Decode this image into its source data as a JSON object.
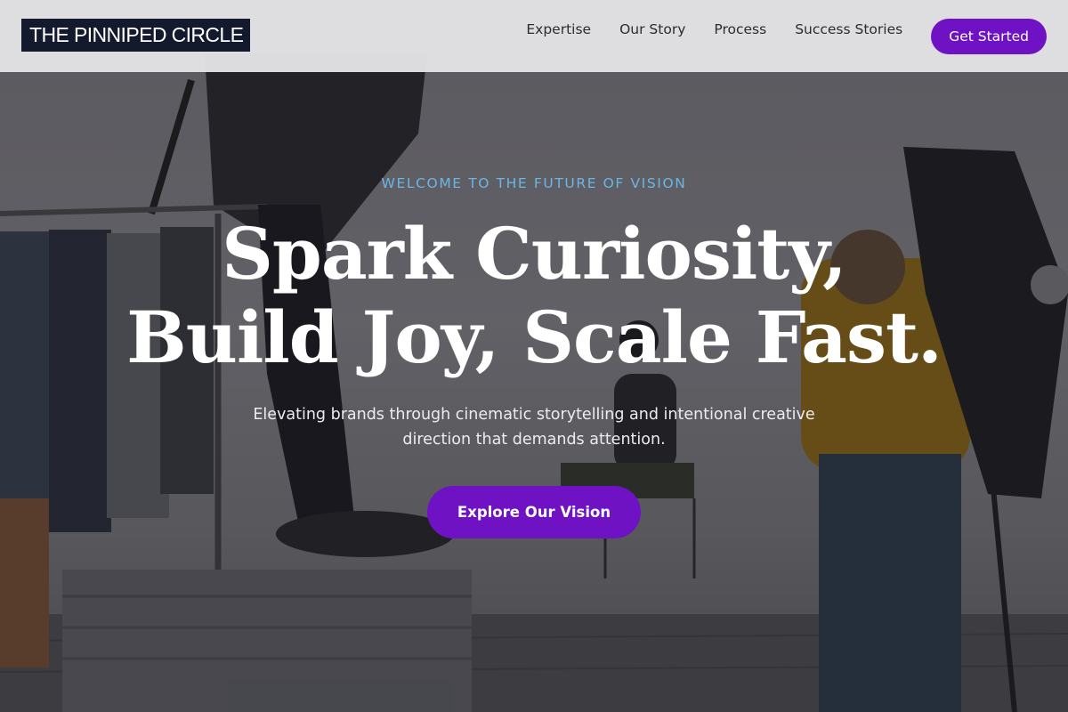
{
  "header": {
    "logo_text": "THE PINNIPED CIRCLE",
    "nav": [
      {
        "label": "Expertise"
      },
      {
        "label": "Our Story"
      },
      {
        "label": "Process"
      },
      {
        "label": "Success Stories"
      }
    ],
    "cta_label": "Get Started"
  },
  "hero": {
    "eyebrow": "WELCOME TO THE FUTURE OF VISION",
    "headline_line1": "Spark Curiosity,",
    "headline_line2": "Build Joy, Scale Fast.",
    "subtext": "Elevating brands through cinematic storytelling and intentional creative direction that demands attention.",
    "button_label": "Explore Our Vision",
    "background_description_icon": "photo-studio-background"
  },
  "colors": {
    "accent": "#6e12c4",
    "eyebrow": "#6bb6e6",
    "logo_bg": "#141a2e",
    "header_bg": "#e2e2e4"
  }
}
